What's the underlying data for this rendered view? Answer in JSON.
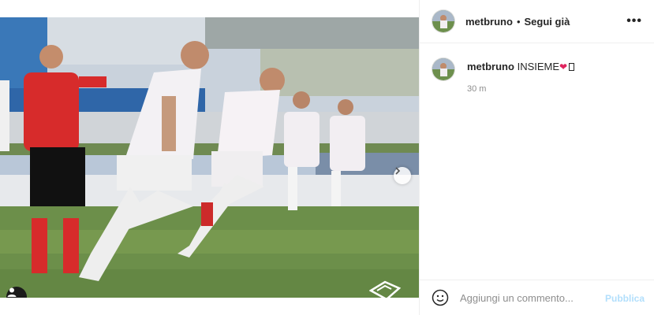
{
  "post": {
    "carousel": {
      "slide_count": 3,
      "active_index": 0
    }
  },
  "header": {
    "username": "metbruno",
    "separator": "•",
    "follow_status": "Segui già",
    "more_label": "•••"
  },
  "caption": {
    "username": "metbruno",
    "text": "INSIEME",
    "heart": "❤",
    "time": "30 m"
  },
  "comment_box": {
    "placeholder": "Aggiungi un commento...",
    "publish_label": "Pubblica"
  },
  "colors": {
    "link_disabled": "#b2dffc",
    "active_dot": "#3897f0",
    "secondary_text": "#8e8e8e",
    "border": "#efefef"
  },
  "icons": [
    "chevron-right-icon",
    "user-tag-icon",
    "emoji-icon",
    "more-icon",
    "team-logo-icon"
  ]
}
